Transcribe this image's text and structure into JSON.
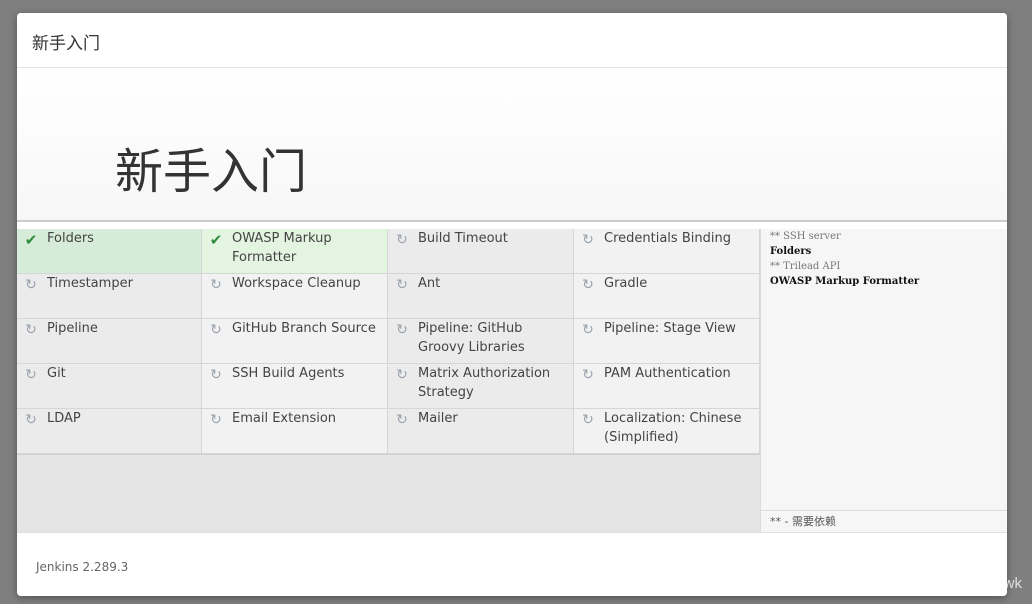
{
  "dialog": {
    "title": "新手入门",
    "hero_title": "新手入门",
    "progress_fraction": 0.045
  },
  "plugins": [
    {
      "name": "Folders",
      "status": "done"
    },
    {
      "name": "OWASP Markup Formatter",
      "status": "done"
    },
    {
      "name": "Build Timeout",
      "status": "pending"
    },
    {
      "name": "Credentials Binding",
      "status": "pending"
    },
    {
      "name": "Timestamper",
      "status": "pending"
    },
    {
      "name": "Workspace Cleanup",
      "status": "pending"
    },
    {
      "name": "Ant",
      "status": "pending"
    },
    {
      "name": "Gradle",
      "status": "pending"
    },
    {
      "name": "Pipeline",
      "status": "pending"
    },
    {
      "name": "GitHub Branch Source",
      "status": "pending"
    },
    {
      "name": "Pipeline: GitHub Groovy Libraries",
      "status": "pending"
    },
    {
      "name": "Pipeline: Stage View",
      "status": "pending"
    },
    {
      "name": "Git",
      "status": "pending"
    },
    {
      "name": "SSH Build Agents",
      "status": "pending"
    },
    {
      "name": "Matrix Authorization Strategy",
      "status": "pending"
    },
    {
      "name": "PAM Authentication",
      "status": "pending"
    },
    {
      "name": "LDAP",
      "status": "pending"
    },
    {
      "name": "Email Extension",
      "status": "pending"
    },
    {
      "name": "Mailer",
      "status": "pending"
    },
    {
      "name": "Localization: Chinese (Simplified)",
      "status": "pending"
    }
  ],
  "log": {
    "lines": [
      {
        "text": "** SSH server",
        "kind": "dep"
      },
      {
        "text": "Folders",
        "kind": "item"
      },
      {
        "text": "** Trilead API",
        "kind": "dep"
      },
      {
        "text": "OWASP Markup Formatter",
        "kind": "item"
      }
    ],
    "footer": "** - 需要依赖"
  },
  "footer": {
    "version": "Jenkins 2.289.3"
  },
  "watermark": "https://blog.csdn.net/RollsRoycewk",
  "icons": {
    "done": "check-icon",
    "pending": "refresh-icon"
  },
  "colors": {
    "done_bg": "#d6ecd8",
    "check": "#2e8b3a",
    "progress": "#3b7cc4"
  }
}
